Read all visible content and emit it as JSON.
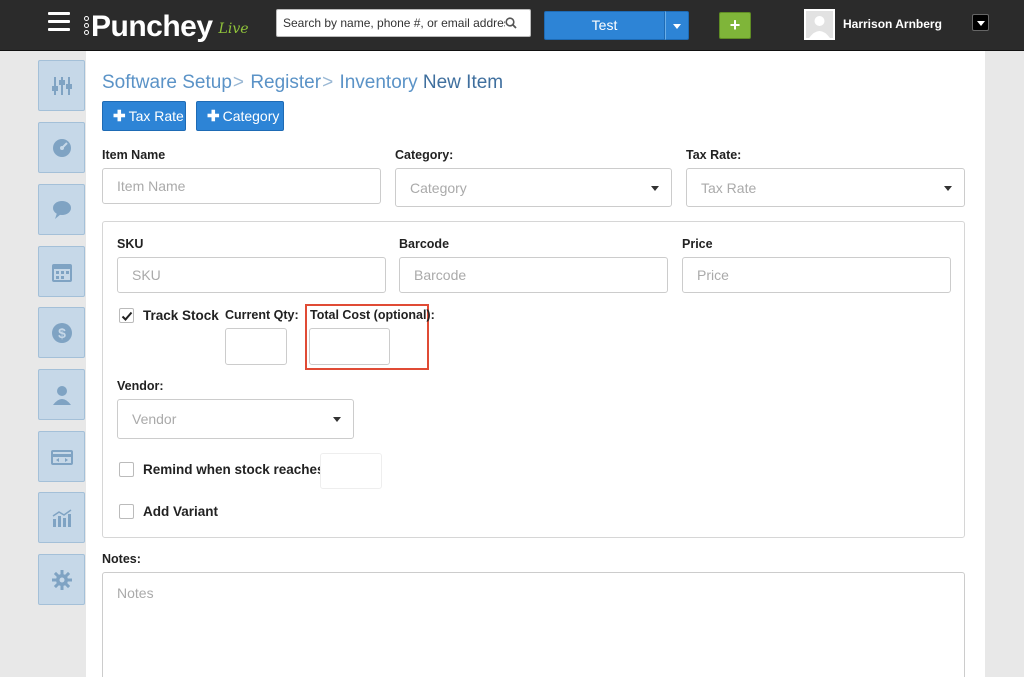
{
  "header": {
    "logo_text": "Punchey",
    "logo_sub": "Live",
    "search_placeholder": "Search by name, phone #, or email address",
    "location_label": "Test",
    "add_label": "+",
    "user_name": "Harrison Arnberg"
  },
  "sidebar": {
    "items": [
      {
        "icon": "sliders-icon"
      },
      {
        "icon": "dashboard-icon"
      },
      {
        "icon": "chat-icon"
      },
      {
        "icon": "calendar-icon"
      },
      {
        "icon": "dollar-icon"
      },
      {
        "icon": "user-icon"
      },
      {
        "icon": "register-icon"
      },
      {
        "icon": "reports-icon"
      },
      {
        "icon": "gear-icon"
      }
    ]
  },
  "breadcrumb": {
    "items": [
      "Software Setup",
      "Register",
      "Inventory"
    ],
    "separator": ">",
    "current": "New Item"
  },
  "actions": {
    "tax_rate_label": "Tax Rate",
    "category_label": "Category"
  },
  "form": {
    "item_name_label": "Item Name",
    "item_name_placeholder": "Item Name",
    "category_label": "Category:",
    "category_placeholder": "Category",
    "tax_rate_label": "Tax Rate:",
    "tax_rate_placeholder": "Tax Rate",
    "sku_label": "SKU",
    "sku_placeholder": "SKU",
    "barcode_label": "Barcode",
    "barcode_placeholder": "Barcode",
    "price_label": "Price",
    "price_placeholder": "Price",
    "track_stock_label": "Track Stock",
    "track_stock_checked": true,
    "current_qty_label": "Current Qty:",
    "total_cost_label": "Total Cost (optional):",
    "vendor_label": "Vendor:",
    "vendor_placeholder": "Vendor",
    "remind_label": "Remind when stock reaches",
    "add_variant_label": "Add Variant",
    "notes_label": "Notes:",
    "notes_placeholder": "Notes"
  },
  "colors": {
    "accent_blue": "#2d84d6",
    "accent_green": "#7fb539",
    "highlight_red": "#e04b35",
    "breadcrumb_blue": "#5b93c7"
  }
}
